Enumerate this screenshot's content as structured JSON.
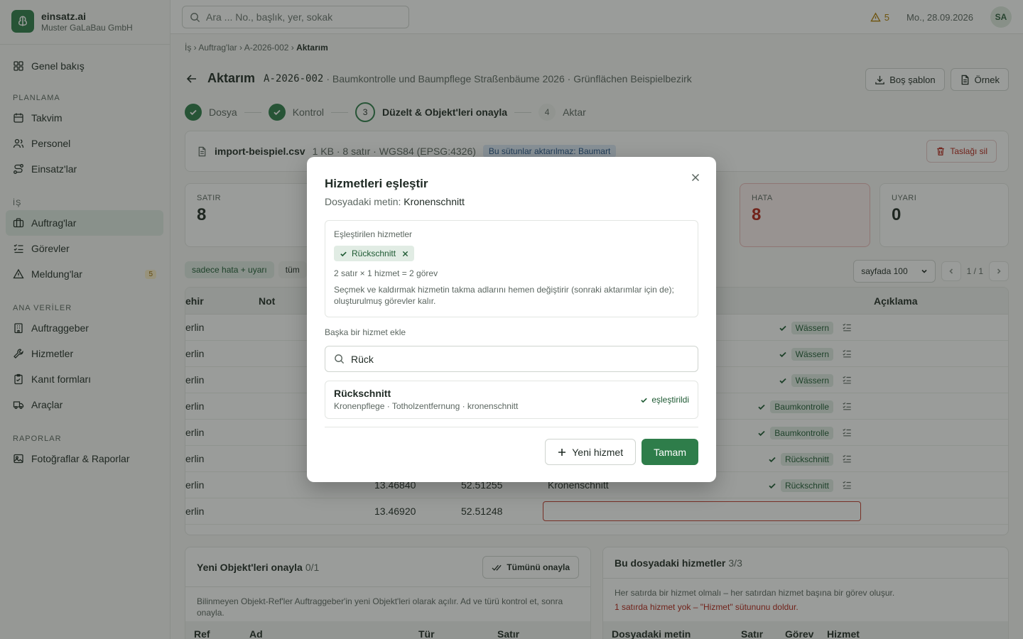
{
  "brand": {
    "name": "einsatz.ai",
    "company": "Muster GaLaBau GmbH"
  },
  "sidebar": {
    "overview": "Genel bakış",
    "sections": [
      {
        "title": "PLANLAMA",
        "items": [
          "Takvim",
          "Personel",
          "Einsatz'lar"
        ]
      },
      {
        "title": "İŞ",
        "items": [
          "Auftrag'lar",
          "Görevler",
          "Meldung'lar"
        ]
      },
      {
        "title": "ANA VERİLER",
        "items": [
          "Auftraggeber",
          "Hizmetler",
          "Kanıt formları",
          "Araçlar"
        ]
      },
      {
        "title": "RAPORLAR",
        "items": [
          "Fotoğraflar & Raporlar"
        ]
      }
    ],
    "meldung_badge": "5"
  },
  "topbar": {
    "search_placeholder": "Ara ... No., başlık, yer, sokak",
    "warnings": "5",
    "date": "Mo., 28.09.2026",
    "avatar": "SA"
  },
  "breadcrumb": {
    "part1": "İş",
    "part2": "Auftrag'lar",
    "part3": "A-2026-002",
    "current": "Aktarım"
  },
  "header": {
    "title": "Aktarım",
    "ref": "A-2026-002",
    "subtitle": "· Baumkontrolle und Baumpflege Straßenbäume 2026 · Grünflächen Beispielbezirk",
    "btn_template": "Boş şablon",
    "btn_example": "Örnek"
  },
  "steps": [
    {
      "num": "",
      "label": "Dosya"
    },
    {
      "num": "",
      "label": "Kontrol"
    },
    {
      "num": "3",
      "label": "Düzelt & Objekt'leri onayla"
    },
    {
      "num": "4",
      "label": "Aktar"
    }
  ],
  "file": {
    "name": "import-beispiel.csv",
    "meta": "1 KB · 8 satır · WGS84 (EPSG:4326)",
    "notice": "Bu sütunlar aktarılmaz: Baumart",
    "delete": "Taslağı sil"
  },
  "stats": [
    {
      "label": "SATIR",
      "value": "8"
    },
    {
      "label": "HATA",
      "value": "8"
    },
    {
      "label": "UYARI",
      "value": "0"
    }
  ],
  "filters": {
    "errors_only": "sadece hata + uyarı",
    "all": "tüm"
  },
  "pager": {
    "per_page": "sayfada 100",
    "page": "1 / 1"
  },
  "table": {
    "columns": {
      "city": "ehir",
      "note": "Not",
      "desc": "Açıklama"
    },
    "rows": [
      {
        "city": "erlin",
        "lon": "",
        "lat": "",
        "text": "",
        "service": "Wässern"
      },
      {
        "city": "erlin",
        "lon": "",
        "lat": "",
        "text": "",
        "service": "Wässern"
      },
      {
        "city": "erlin",
        "lon": "",
        "lat": "",
        "text": "",
        "service": "Wässern"
      },
      {
        "city": "erlin",
        "lon": "",
        "lat": "",
        "text": "",
        "service": "Baumkontrolle"
      },
      {
        "city": "erlin",
        "lon": "",
        "lat": "",
        "text": "",
        "service": "Baumkontrolle"
      },
      {
        "city": "erlin",
        "lon": "",
        "lat": "",
        "text": "",
        "service": "Rückschnitt"
      },
      {
        "city": "erlin",
        "lon": "13.46840",
        "lat": "52.51255",
        "text": "Kronenschnitt",
        "service": "Rückschnitt"
      },
      {
        "city": "erlin",
        "lon": "13.46920",
        "lat": "52.51248",
        "text": "",
        "service": ""
      }
    ]
  },
  "panel_objects": {
    "title": "Yeni Objekt'leri onayla",
    "count": "0/1",
    "btn": "Tümünü onayla",
    "text": "Bilinmeyen Objekt-Ref'ler Auftraggeber'in yeni Objekt'leri olarak açılır. Ad ve türü kontrol et, sonra onayla.",
    "cols": [
      "Ref",
      "Ad",
      "Tür",
      "Satır"
    ]
  },
  "panel_services": {
    "title": "Bu dosyadaki hizmetler",
    "count": "3/3",
    "text": "Her satırda bir hizmet olmalı – her satırdan hizmet başına bir görev oluşur.",
    "error": "1 satırda hizmet yok – \"Hizmet\" sütununu doldur.",
    "cols": [
      "Dosyadaki metin",
      "Satır",
      "Görev",
      "Hizmet"
    ]
  },
  "modal": {
    "title": "Hizmetleri eşleştir",
    "sub_label": "Dosyadaki metin:",
    "sub_value": "Kronenschnitt",
    "matched_caption": "Eşleştirilen hizmetler",
    "matched_chip": "Rückschnitt",
    "calc": "2 satır × 1 hizmet = 2 görev",
    "note": "Seçmek ve kaldırmak hizmetin takma adlarını hemen değiştirir (sonraki aktarımlar için de); oluşturulmuş görevler kalır.",
    "add_label": "Başka bir hizmet ekle",
    "search_value": "Rück",
    "result_title": "Rückschnitt",
    "result_sub": "Kronenpflege · Totholzentfernung · kronenschnitt",
    "result_status": "eşleştirildi",
    "btn_new": "Yeni hizmet",
    "btn_ok": "Tamam"
  },
  "colors": {
    "accent": "#2e7d4a",
    "error": "#b42318",
    "warning": "#b07d00"
  }
}
